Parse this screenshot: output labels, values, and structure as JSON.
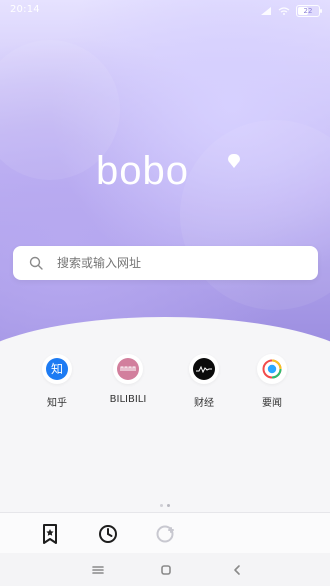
{
  "status_bar": {
    "time": "20:14",
    "battery_text": "22",
    "battery_level": 0.22
  },
  "brand": {
    "logo_text": "bobo"
  },
  "search": {
    "placeholder": "搜索或输入网址"
  },
  "shortcuts": [
    {
      "label": "知乎",
      "badge_text": "知",
      "icon": "zhihu-icon"
    },
    {
      "label": "BILIBILI",
      "icon": "bilibili-icon"
    },
    {
      "label": "财经",
      "icon": "finance-icon"
    },
    {
      "label": "要闻",
      "icon": "headlines-icon"
    }
  ],
  "pager": {
    "page_count": 2,
    "active_index": 1
  },
  "colors": {
    "accent": "#1d7bf3",
    "hero_top": "#e6e2ff",
    "hero_bottom": "#9c8ee0"
  },
  "toolbar": {
    "items": [
      {
        "icon": "bookmark-icon"
      },
      {
        "icon": "history-icon"
      },
      {
        "icon": "add-tab-icon"
      }
    ]
  },
  "navbar": {
    "items": [
      {
        "icon": "menu-icon"
      },
      {
        "icon": "home-icon"
      },
      {
        "icon": "back-icon"
      }
    ]
  }
}
